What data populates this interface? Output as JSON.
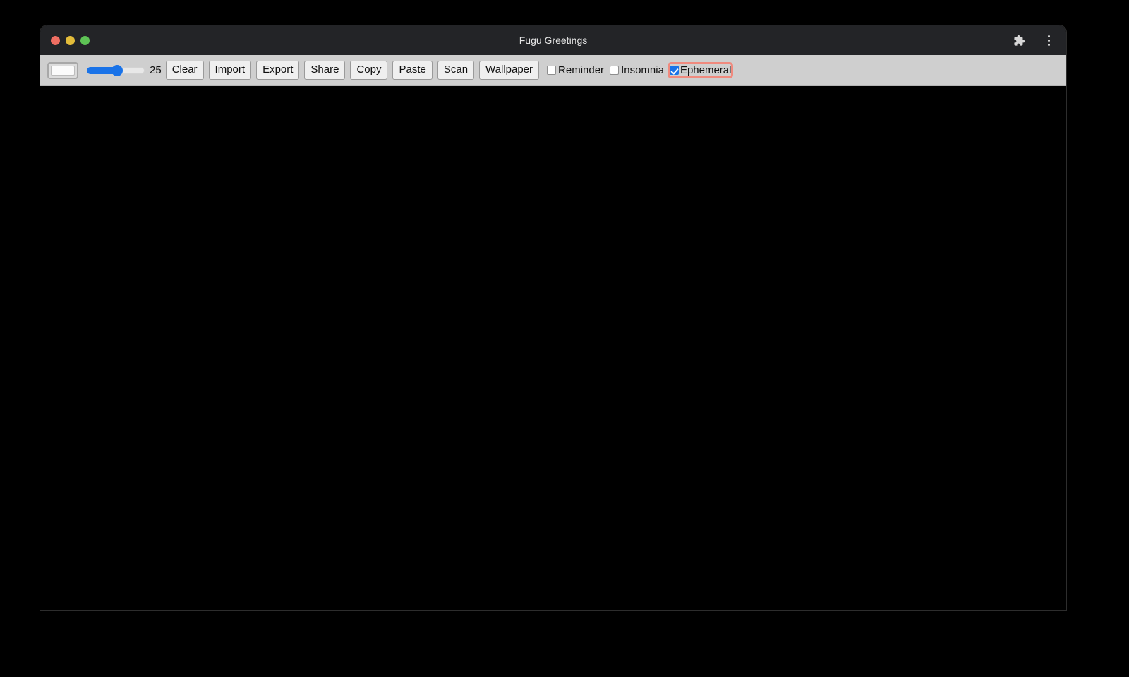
{
  "window": {
    "title": "Fugu Greetings",
    "traffic_lights": [
      {
        "name": "close",
        "color": "#ef6e62"
      },
      {
        "name": "minimize",
        "color": "#e3bc3a"
      },
      {
        "name": "maximize",
        "color": "#5ec355"
      }
    ],
    "titlebar_icons": [
      {
        "name": "extensions-icon",
        "glyph": "puzzle"
      },
      {
        "name": "browser-menu-icon",
        "glyph": "three-dots-vertical"
      }
    ]
  },
  "toolbar": {
    "color_picker": {
      "label": "color-picker",
      "value": "#fbfbfb"
    },
    "slider": {
      "label": "line-width-slider",
      "value": "25",
      "min": "1",
      "max": "50",
      "percent": 52,
      "accent": "#1a73e8"
    },
    "buttons": [
      {
        "name": "clear-button",
        "label": "Clear"
      },
      {
        "name": "import-button",
        "label": "Import"
      },
      {
        "name": "export-button",
        "label": "Export"
      },
      {
        "name": "share-button",
        "label": "Share"
      },
      {
        "name": "copy-button",
        "label": "Copy"
      },
      {
        "name": "paste-button",
        "label": "Paste"
      },
      {
        "name": "scan-button",
        "label": "Scan"
      },
      {
        "name": "wallpaper-button",
        "label": "Wallpaper"
      }
    ],
    "checkboxes": [
      {
        "name": "reminder-checkbox",
        "label": "Reminder",
        "checked": false,
        "focused": false
      },
      {
        "name": "insomnia-checkbox",
        "label": "Insomnia",
        "checked": false,
        "focused": false
      },
      {
        "name": "ephemeral-checkbox",
        "label": "Ephemeral",
        "checked": true,
        "focused": true
      }
    ]
  },
  "canvas": {
    "name": "drawing-canvas",
    "background": "#000000"
  }
}
